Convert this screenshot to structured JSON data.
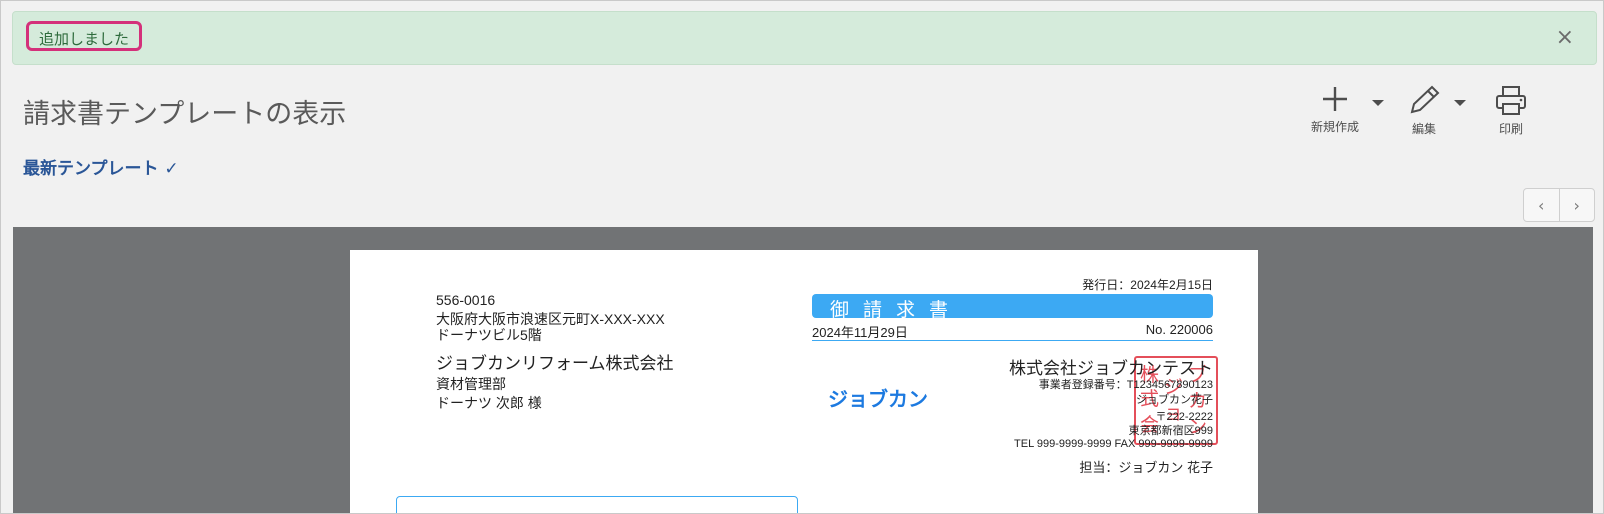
{
  "banner": {
    "message": "追加しました",
    "close": "×"
  },
  "page": {
    "title": "請求書テンプレートの表示",
    "latest_link": "最新テンプレート ✓"
  },
  "toolbar": {
    "new_label": "新規作成",
    "edit_label": "編集",
    "print_label": "印刷",
    "icons": {
      "new": "plus-icon",
      "edit": "pencil-icon",
      "print": "printer-icon"
    }
  },
  "pager": {
    "prev": "‹",
    "next": "›"
  },
  "invoice": {
    "recipient": {
      "postal": "556-0016",
      "address1": "大阪府大阪市浪速区元町X-XXX-XXX",
      "address2": "ドーナツビル5階",
      "company": "ジョブカンリフォーム株式会社",
      "department": "資材管理部",
      "person": "ドーナツ 次郎 様"
    },
    "issue_date": "発行日：2024年2月15日",
    "title": "御請求書",
    "date": "2024年11月29日",
    "number": "No. 220006",
    "logo_text": "ジョブカン",
    "issuer": {
      "company": "株式会社ジョブカンテスト",
      "registration": "事業者登録番号：T1234567890123",
      "person": "ジョブカン花子",
      "postal": "〒222-2222",
      "address": "東京都新宿区999",
      "tel_fax": "TEL 999-9999-9999 FAX 999-9999-9999",
      "contact": "担当：ジョブカン 花子"
    },
    "stamp_chars": [
      "株",
      "式",
      "会",
      "社",
      "ジ",
      "ョ",
      "ブ",
      "カ",
      "ン"
    ]
  },
  "colors": {
    "accent": "#3ca9f3",
    "banner_bg": "#d5ebdb",
    "highlight": "#d4307a",
    "stamp": "#e0313e",
    "link": "#2a5697"
  }
}
